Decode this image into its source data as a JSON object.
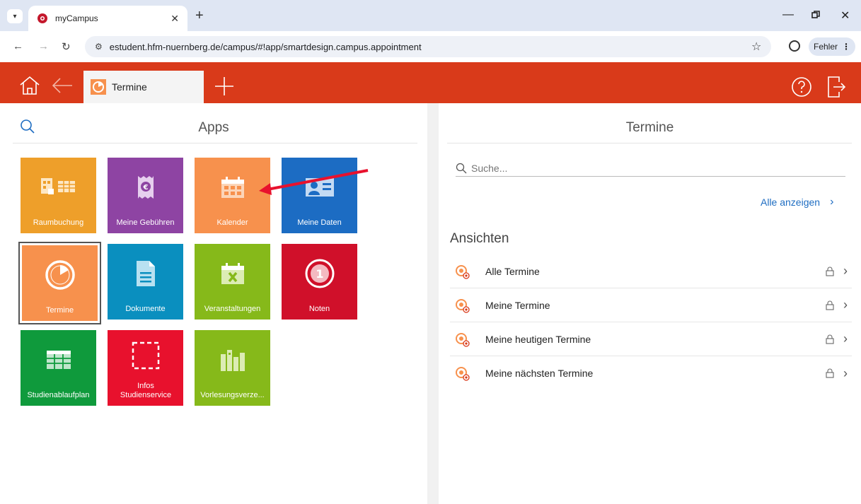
{
  "browser": {
    "tab_title": "myCampus",
    "url": "estudent.hfm-nuernberg.de/campus/#!app/smartdesign.campus.appointment",
    "profile_label": "Fehler",
    "menu_glyph": "⋮"
  },
  "app_header": {
    "open_tab_label": "Termine",
    "accent_color": "#d93a1a"
  },
  "apps_panel": {
    "title": "Apps",
    "tiles": [
      {
        "label": "Raumbuchung",
        "color": "#ee9f2a",
        "icon": "room-booking-icon"
      },
      {
        "label": "Meine Gebühren",
        "color": "#8e44a3",
        "icon": "fees-receipt-icon"
      },
      {
        "label": "Kalender",
        "color": "#f7914d",
        "icon": "calendar-icon"
      },
      {
        "label": "Meine Daten",
        "color": "#1c6cc3",
        "icon": "id-card-icon"
      },
      {
        "label": "Termine",
        "color": "#f7914d",
        "icon": "appointment-clock-icon"
      },
      {
        "label": "Dokumente",
        "color": "#0a8fbf",
        "icon": "document-icon"
      },
      {
        "label": "Veranstaltungen",
        "color": "#86b91a",
        "icon": "event-calendar-icon"
      },
      {
        "label": "Noten",
        "color": "#d0102a",
        "icon": "grades-badge-icon"
      },
      {
        "label": "Studienablaufplan",
        "color": "#0f9a3c",
        "icon": "study-plan-icon"
      },
      {
        "label": "Infos Studienservice",
        "color": "#e8112d",
        "icon": "info-frame-icon"
      },
      {
        "label": "Vorlesungsverze...",
        "color": "#86b91a",
        "icon": "books-icon"
      }
    ]
  },
  "termine_panel": {
    "title": "Termine",
    "search_placeholder": "Suche...",
    "show_all_label": "Alle anzeigen",
    "views_heading": "Ansichten",
    "views": [
      {
        "label": "Alle Termine"
      },
      {
        "label": "Meine Termine"
      },
      {
        "label": "Meine heutigen Termine"
      },
      {
        "label": "Meine nächsten Termine"
      }
    ]
  }
}
